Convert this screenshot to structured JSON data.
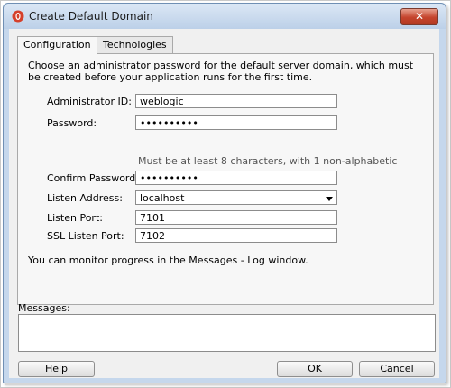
{
  "window": {
    "title": "Create Default Domain",
    "close_glyph": "✕"
  },
  "tabs": [
    {
      "label": "Configuration",
      "active": true
    },
    {
      "label": "Technologies",
      "active": false
    }
  ],
  "form": {
    "intro": "Choose an administrator password for the default server domain, which must be created before your application runs for the first time.",
    "admin_id": {
      "label": "Administrator ID:",
      "value": "weblogic"
    },
    "password": {
      "label": "Password:",
      "value": "••••••••••"
    },
    "password_hint": "Must be at least 8 characters, with 1 non-alphabetic",
    "confirm_password": {
      "label": "Confirm Password:",
      "value": "••••••••••"
    },
    "listen_address": {
      "label": "Listen Address:",
      "value": "localhost"
    },
    "listen_port": {
      "label": "Listen Port:",
      "value": "7101"
    },
    "ssl_listen_port": {
      "label": "SSL Listen Port:",
      "value": "7102"
    },
    "monitor_text": "You can monitor progress in the Messages - Log window."
  },
  "messages": {
    "label": "Messages:",
    "content": ""
  },
  "buttons": {
    "help": "Help",
    "ok": "OK",
    "cancel": "Cancel"
  },
  "colors": {
    "titlebar": "#c5d7ec",
    "close": "#c5442d",
    "dialog_bg": "#f0f0f0",
    "icon_red": "#d5402b"
  }
}
